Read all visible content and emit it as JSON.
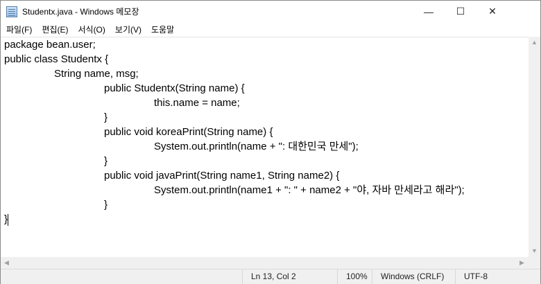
{
  "window": {
    "title": "Studentx.java - Windows 메모장",
    "minimize": "—",
    "maximize": "☐",
    "close": "✕"
  },
  "menu": [
    "파일(F)",
    "편집(E)",
    "서식(O)",
    "보기(V)",
    "도움말"
  ],
  "lines": [
    {
      "indent": 0,
      "text": "package bean.user;"
    },
    {
      "indent": 0,
      "text": "public class Studentx {"
    },
    {
      "indent": 1,
      "text": "String name, msg;"
    },
    {
      "indent": 2,
      "text": "public Studentx(String name) {"
    },
    {
      "indent": 3,
      "text": "this.name = name;"
    },
    {
      "indent": 2,
      "text": "}"
    },
    {
      "indent": 2,
      "text": "public void koreaPrint(String name) {"
    },
    {
      "indent": 3,
      "text": "System.out.println(name + \": 대한민국 만세\");"
    },
    {
      "indent": 2,
      "text": "}"
    },
    {
      "indent": 2,
      "text": "public void javaPrint(String name1, String name2) {"
    },
    {
      "indent": 3,
      "text": "System.out.println(name1 + \": \" + name2 + \"야, 자바 만세라고 해라\");"
    },
    {
      "indent": 2,
      "text": "}"
    },
    {
      "indent": 0,
      "text": "}"
    }
  ],
  "status": {
    "position": "Ln 13, Col 2",
    "zoom": "100%",
    "line_ending": "Windows (CRLF)",
    "encoding": "UTF-8"
  }
}
